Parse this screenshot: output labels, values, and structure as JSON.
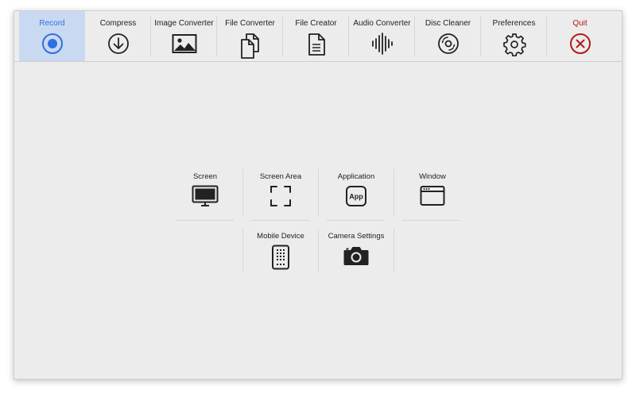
{
  "toolbar": {
    "items": [
      {
        "label": "Record",
        "icon": "record-icon"
      },
      {
        "label": "Compress",
        "icon": "download-circle-icon"
      },
      {
        "label": "Image Converter",
        "icon": "image-icon"
      },
      {
        "label": "File Converter",
        "icon": "files-icon"
      },
      {
        "label": "File Creator",
        "icon": "document-icon"
      },
      {
        "label": "Audio Converter",
        "icon": "waveform-icon"
      },
      {
        "label": "Disc Cleaner",
        "icon": "disc-icon"
      },
      {
        "label": "Preferences",
        "icon": "gear-icon"
      },
      {
        "label": "Quit",
        "icon": "close-circle-icon"
      }
    ],
    "active_index": 0
  },
  "record_options": {
    "items": [
      {
        "label": "Screen",
        "icon": "monitor-icon"
      },
      {
        "label": "Screen Area",
        "icon": "crop-area-icon"
      },
      {
        "label": "Application",
        "icon": "app-icon",
        "icon_text": "App"
      },
      {
        "label": "Window",
        "icon": "window-icon"
      },
      {
        "label": "Mobile Device",
        "icon": "mobile-device-icon"
      },
      {
        "label": "Camera Settings",
        "icon": "camera-icon"
      }
    ]
  },
  "colors": {
    "accent": "#2f6fe0",
    "active_bg": "#c9d9f1",
    "quit": "#b31b1b",
    "window_bg": "#ececec"
  }
}
